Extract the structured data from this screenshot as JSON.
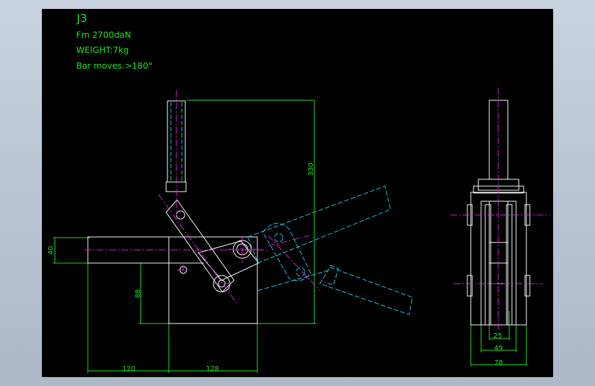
{
  "drawing": {
    "title": "J3",
    "notes": [
      "Fm 2700daN",
      "WEIGHT:7kg",
      "Bar moves.>180°"
    ],
    "dimensions": {
      "height_330": "330",
      "height_40": "40",
      "height_88": "88",
      "width_120": "120",
      "width_128": "128",
      "width_25": "25",
      "width_49": "49",
      "width_78": "78"
    },
    "colors": {
      "background": "#000000",
      "outline": "#ffffff",
      "dimension": "#1ee81e",
      "centerline": "#e020e0",
      "phantom": "#1ec8e8"
    }
  }
}
